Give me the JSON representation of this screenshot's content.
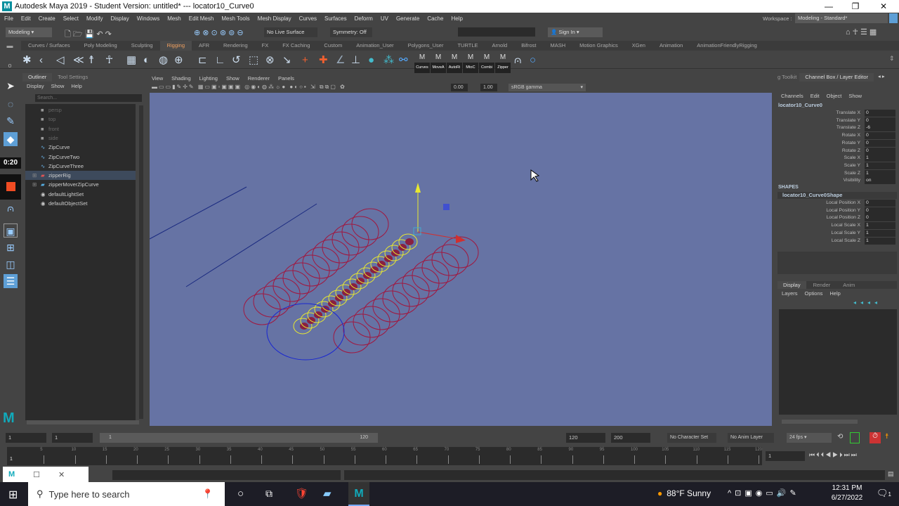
{
  "window": {
    "title": "Autodesk Maya 2019 - Student Version: untitled*   ---   locator10_Curve0",
    "minimize": "—",
    "maximize": "❐",
    "close": "✕"
  },
  "menu": [
    "File",
    "Edit",
    "Create",
    "Select",
    "Modify",
    "Display",
    "Windows",
    "Mesh",
    "Edit Mesh",
    "Mesh Tools",
    "Mesh Display",
    "Curves",
    "Surfaces",
    "Deform",
    "UV",
    "Generate",
    "Cache",
    "Help"
  ],
  "status_line": {
    "menu_set": "Modeling",
    "live_surface": "No Live Surface",
    "symmetry": "Symmetry: Off",
    "sign_in": "Sign In",
    "workspace_label": "Workspace :",
    "workspace": "Modeling - Standard*"
  },
  "shelf_tabs": [
    "Curves / Surfaces",
    "Poly Modeling",
    "Sculpting",
    "Rigging",
    "AFR",
    "Rendering",
    "FX",
    "FX Caching",
    "Custom",
    "Animation_User",
    "Polygons_User",
    "TURTLE",
    "Arnold",
    "Bifrost",
    "MASH",
    "Motion Graphics",
    "XGen",
    "Animation",
    "AnimationFriendlyRigging"
  ],
  "active_shelf": "Rigging",
  "shelf_buttons": [
    "Curves",
    "MoveA",
    "AutoRi",
    "MtoC",
    "Combi",
    "Zipper"
  ],
  "recording": {
    "time": "0:20"
  },
  "outliner": {
    "tabs": [
      "Outliner",
      "Tool Settings"
    ],
    "menu": [
      "Display",
      "Show",
      "Help"
    ],
    "search_placeholder": "Search...",
    "items": [
      {
        "label": "persp",
        "dim": true
      },
      {
        "label": "top",
        "dim": true
      },
      {
        "label": "front",
        "dim": true
      },
      {
        "label": "side",
        "dim": true
      },
      {
        "label": "ZipCurve"
      },
      {
        "label": "ZipCurveTwo"
      },
      {
        "label": "ZipCurveThree"
      },
      {
        "label": "zipperRig",
        "selected": true
      },
      {
        "label": "zipperMoverZipCurve"
      },
      {
        "label": "defaultLightSet"
      },
      {
        "label": "defaultObjectSet"
      }
    ]
  },
  "viewport": {
    "menu": [
      "View",
      "Shading",
      "Lighting",
      "Show",
      "Renderer",
      "Panels"
    ],
    "exposure": "0.00",
    "gamma": "1.00",
    "color_space": "sRGB gamma"
  },
  "channel_box": {
    "tabs": [
      "g Toolkit",
      "Channel Box / Layer Editor"
    ],
    "menu": [
      "Channels",
      "Edit",
      "Object",
      "Show"
    ],
    "object": "locator10_Curve0",
    "channels": [
      {
        "label": "Translate X",
        "value": "0"
      },
      {
        "label": "Translate Y",
        "value": "0"
      },
      {
        "label": "Translate Z",
        "value": "-6"
      },
      {
        "label": "Rotate X",
        "value": "0"
      },
      {
        "label": "Rotate Y",
        "value": "0"
      },
      {
        "label": "Rotate Z",
        "value": "0"
      },
      {
        "label": "Scale X",
        "value": "1"
      },
      {
        "label": "Scale Y",
        "value": "1"
      },
      {
        "label": "Scale Z",
        "value": "1"
      },
      {
        "label": "Visibility",
        "value": "on"
      }
    ],
    "shapes_label": "SHAPES",
    "shape": "locator10_Curve0Shape",
    "shape_channels": [
      {
        "label": "Local Position X",
        "value": "0"
      },
      {
        "label": "Local Position Y",
        "value": "0"
      },
      {
        "label": "Local Position Z",
        "value": "0"
      },
      {
        "label": "Local Scale X",
        "value": "1"
      },
      {
        "label": "Local Scale Y",
        "value": "1"
      },
      {
        "label": "Local Scale Z",
        "value": "1"
      }
    ]
  },
  "layer_editor": {
    "tabs": [
      "Display",
      "Render",
      "Anim"
    ],
    "menu": [
      "Layers",
      "Options",
      "Help"
    ]
  },
  "range_slider": {
    "start": "1",
    "current_start": "1",
    "range_start": "1",
    "range_end": "120",
    "end": "120",
    "anim_end": "200",
    "character_set": "No Character Set",
    "anim_layer": "No Anim Layer",
    "fps": "24 fps"
  },
  "timeline": {
    "ticks": [
      "5",
      "10",
      "15",
      "20",
      "25",
      "30",
      "35",
      "40",
      "45",
      "50",
      "55",
      "60",
      "65",
      "70",
      "75",
      "80",
      "85",
      "90",
      "95",
      "100",
      "105",
      "110",
      "115",
      "120"
    ],
    "current_frame": "1",
    "frame_field": "1"
  },
  "taskbar": {
    "search_placeholder": "Type here to search",
    "weather": "88°F  Sunny",
    "time": "12:31 PM",
    "date": "6/27/2022",
    "notifications": "1"
  }
}
